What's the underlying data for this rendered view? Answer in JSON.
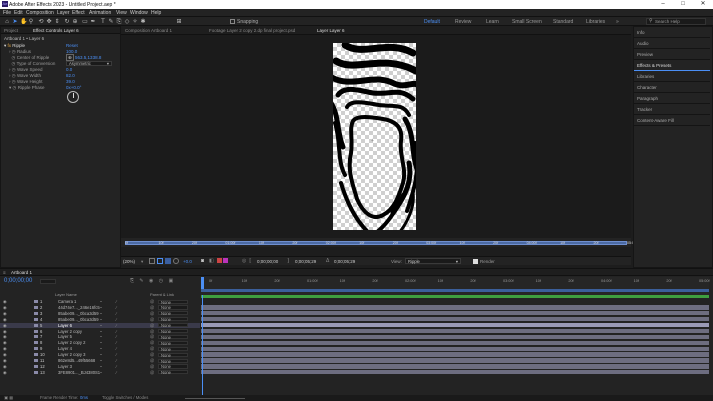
{
  "app": {
    "title": "Adobe After Effects 2023 - Untitled Project.aep *",
    "icon_label": "Ae"
  },
  "window_controls": [
    "–",
    "□",
    "✕"
  ],
  "menu": [
    "File",
    "Edit",
    "Composition",
    "Layer",
    "Effect",
    "Animation",
    "View",
    "Window",
    "Help"
  ],
  "toolbar": {
    "snapping": "Snapping",
    "workspaces": [
      "Default",
      "Review",
      "Learn",
      "Small Screen",
      "Standard",
      "Libraries"
    ],
    "active_workspace": "Default",
    "search_placeholder": "Search Help"
  },
  "left_panel": {
    "tabs": [
      "Project",
      "Effect Controls  Layer 6"
    ],
    "header": "Artboard 1 • Layer 6",
    "effect_name": "Ripple",
    "reset": "Reset",
    "props": [
      {
        "label": "Radius",
        "value": "100.0"
      },
      {
        "label": "Center of Ripple",
        "value": "563.5,1338.8"
      },
      {
        "label": "Type of Conversion",
        "value": "Asymmetric"
      },
      {
        "label": "Wave Speed",
        "value": "0.0"
      },
      {
        "label": "Wave Width",
        "value": "82.0"
      },
      {
        "label": "Wave Height",
        "value": "39.0"
      },
      {
        "label": "Ripple Phase",
        "value": "0x+0.0°"
      }
    ]
  },
  "viewer": {
    "tabs": [
      "Composition  Artboard 1",
      "Footage  Layer 2 copy 2.dp final project.psd",
      "Layer  Layer 6"
    ],
    "ruler": [
      "0f",
      "10f",
      "20f",
      "01:00f",
      "10f",
      "20f",
      "02:00f",
      "10f",
      "20f",
      "03:00f",
      "10f",
      "20f",
      "04:00f",
      "10f",
      "20f",
      "05:00f"
    ],
    "zoom": "(20%)",
    "time1": "0;00;00;00",
    "time2": "0;00;05;29",
    "time3": "0;00;05;29",
    "view_label": "View:",
    "view_value": "Ripple",
    "render": "Render"
  },
  "right_panel": [
    "Info",
    "Audio",
    "Preview",
    "Effects & Presets",
    "Libraries",
    "Character",
    "Paragraph",
    "Tracker",
    "Content-Aware Fill"
  ],
  "timeline": {
    "tab": "Artboard 1",
    "timecode": "0;00;00;00",
    "headers": {
      "layer_name": "Layer Name",
      "parent": "Parent & Link"
    },
    "ruler": [
      "0f",
      "10f",
      "20f",
      "01:00f",
      "10f",
      "20f",
      "02:00f",
      "10f",
      "20f",
      "03:00f",
      "10f",
      "20f",
      "04:00f",
      "10f",
      "20f",
      "05:00f"
    ],
    "layers": [
      {
        "num": "1",
        "name": "Camera 1",
        "parent": "None"
      },
      {
        "num": "2",
        "name": "44d74e7..._246e16fc5",
        "parent": "None"
      },
      {
        "num": "3",
        "name": "85abe09..._0bca3d59",
        "parent": "None"
      },
      {
        "num": "4",
        "name": "85abe09..._0bca3d59",
        "parent": "None"
      },
      {
        "num": "5",
        "name": "Layer 6",
        "parent": "None"
      },
      {
        "num": "6",
        "name": "Layer 2 copy",
        "parent": "None"
      },
      {
        "num": "7",
        "name": "Layer 5",
        "parent": "None"
      },
      {
        "num": "8",
        "name": "Layer 2 copy 2",
        "parent": "None"
      },
      {
        "num": "9",
        "name": "Layer 4",
        "parent": "None"
      },
      {
        "num": "10",
        "name": "Layer 2 copy 3",
        "parent": "None"
      },
      {
        "num": "11",
        "name": "862e8d5...49f55668",
        "parent": "None"
      },
      {
        "num": "12",
        "name": "Layer 3",
        "parent": "None"
      },
      {
        "num": "13",
        "name": "3FE8901..._BJ4380S1",
        "parent": "None"
      }
    ],
    "selected_layer_index": 4
  },
  "status": {
    "frame_render": "Frame Render Time:",
    "frame_render_value": "0ms",
    "toggle": "Toggle Switches / Modes"
  },
  "colors": {
    "accent": "#4b8ff5",
    "panel": "#232323",
    "track": "#6d6d80",
    "track_selected": "#9a9ab6"
  }
}
